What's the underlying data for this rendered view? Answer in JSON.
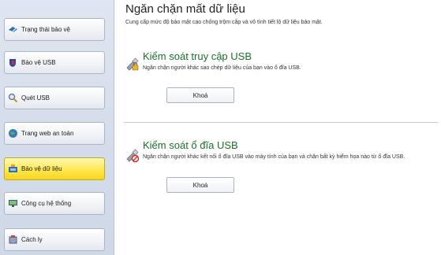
{
  "sidebar": {
    "items": [
      {
        "label": "Trạng thái bảo vệ",
        "icon": "shield-check-icon"
      },
      {
        "label": "Bảo vệ USB",
        "icon": "usb-shield-icon"
      },
      {
        "label": "Quét USB",
        "icon": "magnifier-icon"
      },
      {
        "label": "Trang web an toàn",
        "icon": "globe-icon"
      },
      {
        "label": "Bảo vệ dữ liệu",
        "icon": "data-protection-icon",
        "active": true
      },
      {
        "label": "Công cụ hệ thống",
        "icon": "monitor-tools-icon"
      },
      {
        "label": "Cách ly",
        "icon": "quarantine-icon"
      }
    ]
  },
  "main": {
    "title": "Ngăn chặn mất dữ liệu",
    "description": "Cung cấp mức độ bảo mật cao chống trộm cắp và vô tình tiết lộ dữ liệu bảo mật.",
    "sections": [
      {
        "title": "Kiểm soát truy cập USB",
        "description": "Ngăn chặn người khác sao chép dữ liệu của bạn vào ổ đĩa USB.",
        "button_label": "Khoá",
        "icon": "usb-lock-icon"
      },
      {
        "title": "Kiểm soát ổ đĩa USB",
        "description": "Ngăn chặn người khác kết nối ổ đĩa USB vào máy tính của bạn và chặn bất kỳ hiểm họa nào từ ổ đĩa USB.",
        "button_label": "Khoá",
        "icon": "usb-block-icon"
      }
    ]
  },
  "colors": {
    "accent_green": "#1c6e2c",
    "active_item": "#f9d51d",
    "sidebar_bg": "#d3dcea"
  }
}
